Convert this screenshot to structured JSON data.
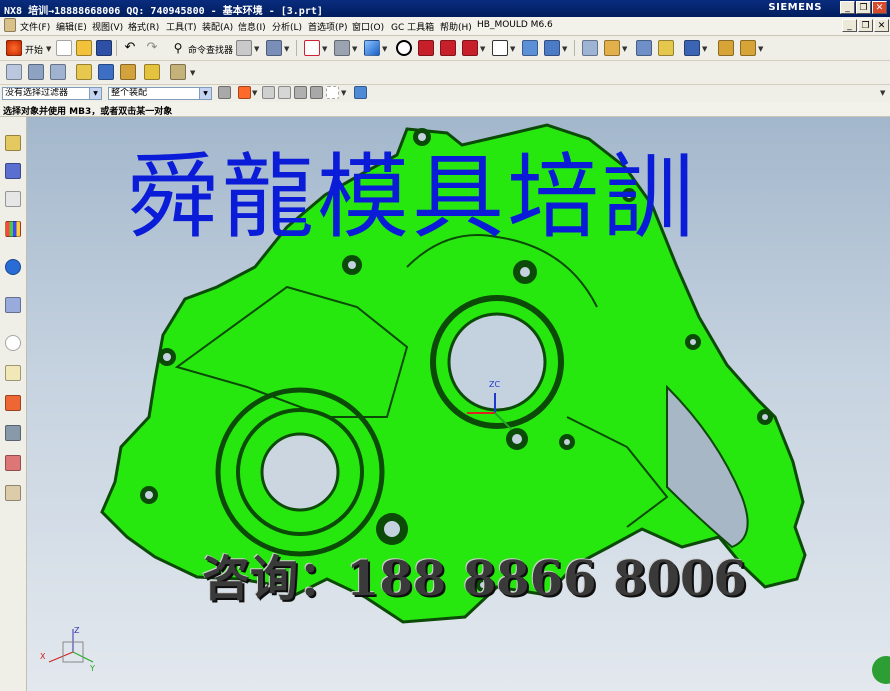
{
  "window": {
    "title": "NX8 培训→18888668006 QQ: 740945800 - 基本环境 - [3.prt]",
    "brand": "SIEMENS",
    "buttons": [
      "_",
      "❐",
      "✕"
    ]
  },
  "menubar": {
    "items": [
      "文件(F)",
      "编辑(E)",
      "视图(V)",
      "格式(R)",
      "工具(T)",
      "装配(A)",
      "信息(I)",
      "分析(L)",
      "首选项(P)",
      "窗口(O)",
      "GC 工具箱",
      "帮助(H)",
      "HB_MOULD M6.6"
    ],
    "doc_buttons": [
      "_",
      "❐",
      "✕"
    ]
  },
  "toolbar1": {
    "start_label": "开始",
    "command_finder_label": "命令查找器"
  },
  "selection_bar": {
    "type_filter": "没有选择过滤器",
    "scope": "整个装配"
  },
  "status": {
    "prompt": "选择对象并使用 MB3，或者双击某一对象"
  },
  "viewport": {
    "watermark": "舜龍模具培訓",
    "contact": "咨询：188 8866 8006",
    "triad_label": "ZC",
    "corner_axes": {
      "z": "Z",
      "x": "X",
      "y": "Y"
    }
  },
  "colors": {
    "part_green": "#27e80e",
    "part_edge": "#0b4a07",
    "watermark_blue": "#0a1cd8",
    "title_blue": "#0a2c7e"
  }
}
